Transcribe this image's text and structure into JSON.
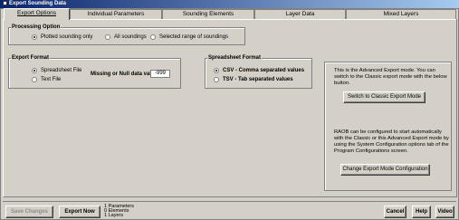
{
  "window": {
    "title": "Export Sounding Data"
  },
  "tabs": [
    {
      "label": "Export Options",
      "active": true
    },
    {
      "label": "Individual Parameters",
      "active": false
    },
    {
      "label": "Sounding Elements",
      "active": false
    },
    {
      "label": "Layer Data",
      "active": false
    },
    {
      "label": "Mixed Layers",
      "active": false
    }
  ],
  "processing": {
    "title": "Processing Option",
    "options": [
      "Plotted sounding only",
      "All soundings",
      "Selected range of soundings"
    ],
    "selected": 0
  },
  "export_format": {
    "title": "Export Format",
    "options": [
      "Spreadsheet File",
      "Text File"
    ],
    "selected": 0,
    "missing_label": "Missing or Null data value:",
    "missing_value": "-999"
  },
  "spreadsheet_format": {
    "title": "Spreadsheet Format",
    "options": [
      "CSV - Comma separated values",
      "TSV - Tab separated values"
    ],
    "selected": 0
  },
  "info": {
    "text1": "This is the Advanced Export mode. You can switch to the Classic export mode with the below button.",
    "switch_button": "Switch to Classic Export Mode",
    "text2": "RAOB can be configured to start automatically with the Classic or this Advanced Export mode by using the System Configuration options tab of the Program Configurations screen.",
    "change_button": "Change Export Mode Configuration"
  },
  "bottom": {
    "save_label": "Save Changes",
    "export_label": "Export Now",
    "summary": [
      "1  Parameters",
      "0  Elements",
      "1  Layers"
    ],
    "cancel_label": "Cancel",
    "help_label": "Help",
    "video_label": "Video"
  }
}
